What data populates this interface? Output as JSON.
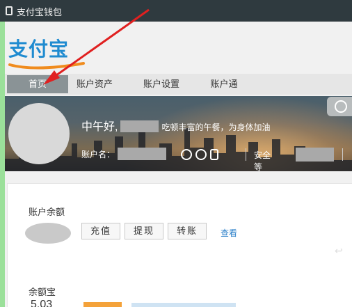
{
  "window": {
    "title": "支付宝钱包"
  },
  "logo": {
    "text": "支付宝"
  },
  "nav": {
    "tabs": [
      "首页",
      "账户资产",
      "账户设置",
      "账户通"
    ]
  },
  "banner": {
    "greeting": "中午好,",
    "tip": "吃顿丰富的午餐，为身体加油",
    "account_label": "账户名：",
    "security_label": "安全等级："
  },
  "balance": {
    "title": "账户余额",
    "buttons": [
      "充值",
      "提现",
      "转账"
    ],
    "view_link": "查看"
  },
  "yuebao": {
    "title": "余额宝",
    "value": "5.03"
  },
  "colors": {
    "accent": "#1f8bd0",
    "nav_active": "#8a9396",
    "link": "#2a7fc9",
    "annotation": "#e02020"
  },
  "icons": [
    "phone-icon",
    "user-icon",
    "shield-icon",
    "mobile-icon",
    "alarm-clock-icon"
  ]
}
